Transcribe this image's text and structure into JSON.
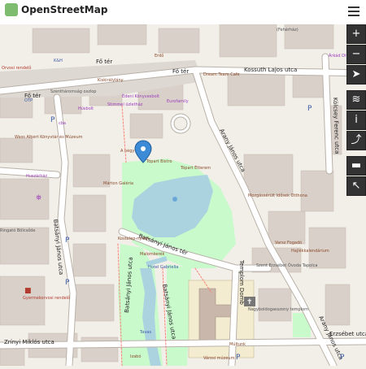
{
  "header": {
    "title": "OpenStreetMap"
  },
  "controls": {
    "zoom_in": "+",
    "zoom_out": "−",
    "locate": "➤",
    "layers": "≋",
    "info": "i",
    "share": "⤴",
    "note": "▬",
    "query": "↖"
  },
  "streets": {
    "fo_ter_1": "Fő tér",
    "fo_ter_2": "Fő tér",
    "fo_ter_3": "Fő tér",
    "kossuth": "Kossuth Lajos utca",
    "kulcsey": "Kölcsey Ferenc utca",
    "arany": "Arany János utca",
    "batsanyi_1": "Batsányi János utca",
    "batsanyi_tr": "Batsányi János tér",
    "batsanyi_2": "Batsányi János utca",
    "batsanyi_3": "Batsányi János utca",
    "templom": "Templom Domb",
    "zrinyi": "Zrínyi Miklós utca",
    "arany_2": "Arany János utca",
    "erzsebet": "Erzsébet utca"
  },
  "pois": {
    "feherhaz": "(Fehérház)",
    "orvos": "Orvosi rendelő",
    "kh": "K&H",
    "erdo": "Erdő",
    "szentharomsag": "Szentháromság oszlop",
    "kiskiralylany": "Kiskirálylány",
    "otp": "OTP",
    "husbolt": "Húsbolt",
    "edeni": "Édeni Könyvesbolt",
    "stimmel": "Stimmel üzletház",
    "eurofamily": "Eurofamily",
    "cba": "cba",
    "wass": "Wass Albert Könyvtár és Múzeum",
    "dream": "Dream Team Cafe",
    "arkad": "Árkád Divat",
    "ganyi": "A négy évszak",
    "topart": "Tópart Bistro",
    "etterem": "Tópart Étterem",
    "huszarhaz": "Huszárház",
    "marton": "Márton Galéria",
    "mozgas": "Mozgássérült Idősek Otthona",
    "ringato": "Ringató Bölcsőde",
    "kostelep": "Kostelep-nyikul",
    "malomkerek": "Malomkerék",
    "hotel": "Hotel Gabriella",
    "varsz": "Varsz Fogadó",
    "hajlek": "Hajlékkalendárium",
    "szent": "Szent Erzsébet Óvoda Tapolca",
    "nagyboldog": "Nagyboldogasszony templom",
    "gyermek": "Gyermekorvosi rendelő",
    "mulunk": "Múltunk",
    "izabo": "Izabó",
    "varosi": "Városi múzeum",
    "tavas": "Tavas"
  }
}
